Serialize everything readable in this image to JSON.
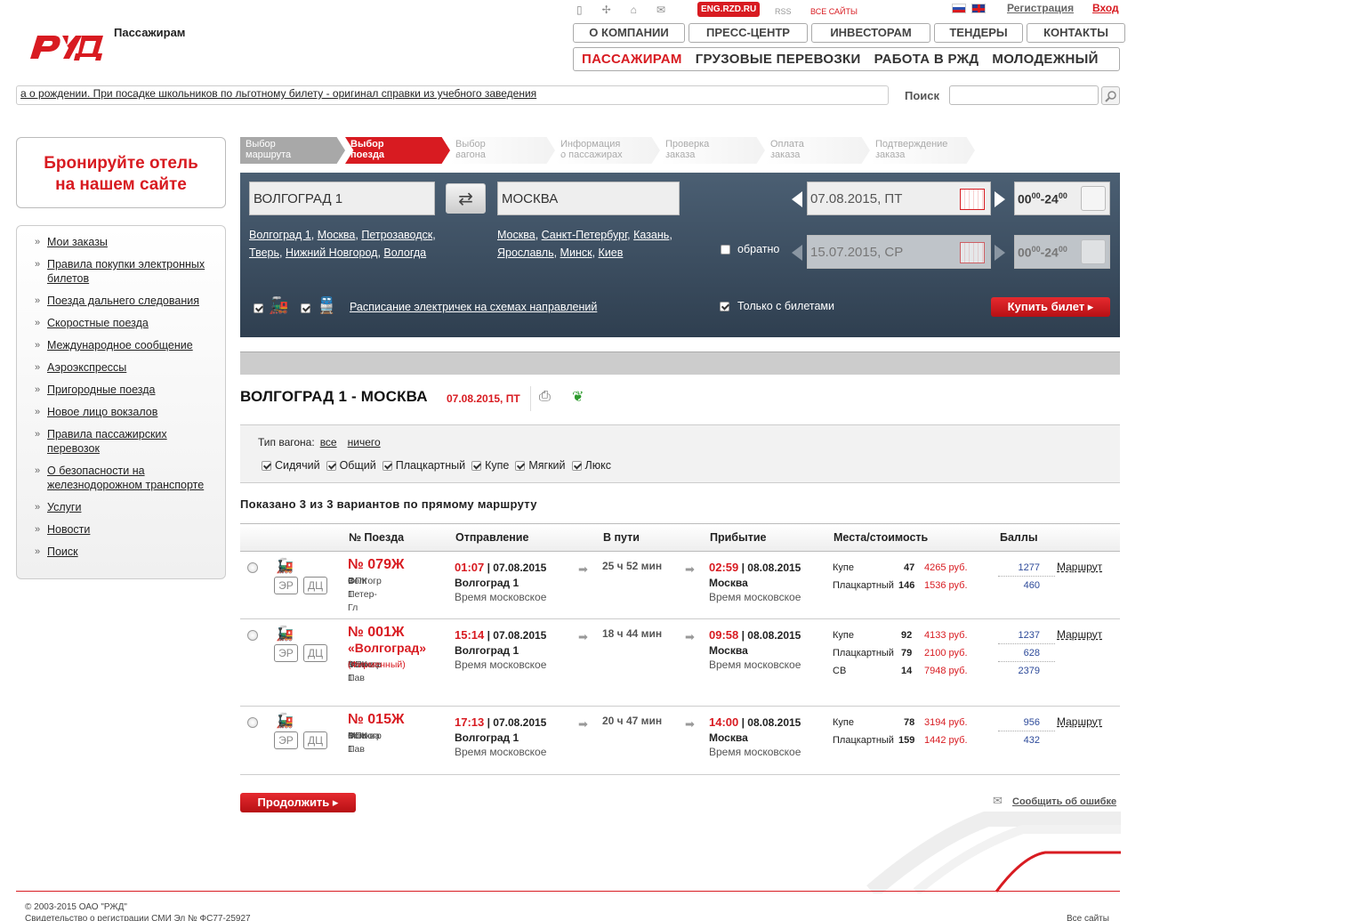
{
  "header": {
    "logo_text": "РЖД",
    "section": "Пассажирам",
    "eng_site": "ENG.RZD.RU",
    "rss": "RSS",
    "all_sites": "ВСЕ САЙТЫ",
    "register": "Регистрация",
    "login": "Вход",
    "top_nav": [
      "О КОМПАНИИ",
      "ПРЕСС-ЦЕНТР",
      "ИНВЕСТОРАМ",
      "ТЕНДЕРЫ",
      "КОНТАКТЫ"
    ],
    "main_nav": [
      "ПАССАЖИРАМ",
      "ГРУЗОВЫЕ ПЕРЕВОЗКИ",
      "РАБОТА В РЖД",
      "МОЛОДЕЖНЫЙ"
    ]
  },
  "ticker": "а о рождении. При посадке школьников по льготному билету - оригинал справки из учебного заведения",
  "search": {
    "label": "Поиск",
    "value": ""
  },
  "hotel_banner": {
    "line1": "Бронируйте отель",
    "line2": "на нашем сайте"
  },
  "sidebar": {
    "items": [
      "Мои заказы",
      "Правила покупки электронных билетов",
      "Поезда дальнего следования",
      "Скоростные поезда",
      "Международное сообщение",
      "Аэроэкспрессы",
      "Пригородные поезда",
      "Новое лицо вокзалов",
      "Правила пассажирских перевозок",
      "О безопасности на железнодорожном транспорте",
      "Услуги",
      "Новости",
      "Поиск"
    ]
  },
  "steps": [
    {
      "l1": "Выбор",
      "l2": "маршрута",
      "state": "done"
    },
    {
      "l1": "Выбор",
      "l2": "поезда",
      "state": "cur"
    },
    {
      "l1": "Выбор",
      "l2": "вагона",
      "state": "future"
    },
    {
      "l1": "Информация",
      "l2": "о пассажирах",
      "state": "future"
    },
    {
      "l1": "Проверка",
      "l2": "заказа",
      "state": "future"
    },
    {
      "l1": "Оплата",
      "l2": "заказа",
      "state": "future"
    },
    {
      "l1": "Подтверждение",
      "l2": "заказа",
      "state": "future"
    }
  ],
  "form": {
    "from": "ВОЛГОГРАД 1",
    "to": "МОСКВА",
    "from_hints": [
      "Волгоград 1",
      "Москва",
      "Петрозаводск",
      "Тверь",
      "Нижний Новгород",
      "Вологда"
    ],
    "to_hints": [
      "Москва",
      "Санкт-Петербург",
      "Казань",
      "Ярославль",
      "Минск",
      "Киев"
    ],
    "date_there": "07.08.2015, ПТ",
    "date_back": "15.07.2015, СР",
    "time_from": "00",
    "time_to": "24",
    "time_min": "00",
    "return_label": "обратно",
    "only_tickets": "Только с билетами",
    "suburban_link": "Расписание электричек на схемах направлений",
    "buy": "Купить билет"
  },
  "result": {
    "title": "ВОЛГОГРАД 1 - МОСКВА",
    "date": "07.08.2015, ПТ",
    "wagon_type_label": "Тип вагона:",
    "all": "все",
    "none": "ничего",
    "types": [
      "Сидячий",
      "Общий",
      "Плацкартный",
      "Купе",
      "Мягкий",
      "Люкс"
    ],
    "shown": "Показано 3 из 3 вариантов по прямому маршруту",
    "columns": [
      "№ Поезда",
      "Отправление",
      "В пути",
      "Прибытие",
      "Места/стоимость",
      "Баллы"
    ],
    "route_link": "Маршрут",
    "moscow_time": "Время московское",
    "er": "ЭР",
    "dc": "ДЦ",
    "trains": [
      {
        "num": "№ 079Ж",
        "name": "",
        "from": "Волгогр 1",
        "to": "С-Петер-Гл",
        "carrier": "ФПК",
        "brand": "",
        "dep_time": "01:07",
        "dep_date": "| 07.08.2015",
        "dep_station": "Волгоград 1",
        "travel": "25 ч 52 мин",
        "arr_time": "02:59",
        "arr_date": "| 08.08.2015",
        "arr_station": "Москва",
        "seats": [
          {
            "type": "Купе",
            "count": "47",
            "price": "4265 руб.",
            "points": "1277"
          },
          {
            "type": "Плацкартный",
            "count": "146",
            "price": "1536 руб.",
            "points": "460"
          }
        ]
      },
      {
        "num": "№ 001Ж",
        "name": "«Волгоград»",
        "from": "Волгогр 1",
        "to": "Москва Пав",
        "carrier": "ФПК",
        "brand": "(Фирменный)",
        "dep_time": "15:14",
        "dep_date": "| 07.08.2015",
        "dep_station": "Волгоград 1",
        "travel": "18 ч 44 мин",
        "arr_time": "09:58",
        "arr_date": "| 08.08.2015",
        "arr_station": "Москва",
        "seats": [
          {
            "type": "Купе",
            "count": "92",
            "price": "4133 руб.",
            "points": "1237"
          },
          {
            "type": "Плацкартный",
            "count": "79",
            "price": "2100 руб.",
            "points": "628"
          },
          {
            "type": "СВ",
            "count": "14",
            "price": "7948 руб.",
            "points": "2379"
          }
        ]
      },
      {
        "num": "№ 015Ж",
        "name": "",
        "from": "Волгогр 1",
        "to": "Москва Пав",
        "carrier": "ФПК",
        "brand": "",
        "dep_time": "17:13",
        "dep_date": "| 07.08.2015",
        "dep_station": "Волгоград 1",
        "travel": "20 ч 47 мин",
        "arr_time": "14:00",
        "arr_date": "| 08.08.2015",
        "arr_station": "Москва",
        "seats": [
          {
            "type": "Купе",
            "count": "78",
            "price": "3194 руб.",
            "points": "956"
          },
          {
            "type": "Плацкартный",
            "count": "159",
            "price": "1442 руб.",
            "points": "432"
          }
        ]
      }
    ],
    "continue": "Продолжить",
    "report": "Сообщить об ошибке"
  },
  "footer": {
    "copyright": "© 2003-2015 ОАО \"РЖД\"",
    "license": "Свидетельство о регистрации СМИ Эл № ФС77-25927",
    "all_sites": "Все сайты"
  },
  "colors": {
    "brand_red": "#d81b21",
    "panel": "#3d5062"
  }
}
